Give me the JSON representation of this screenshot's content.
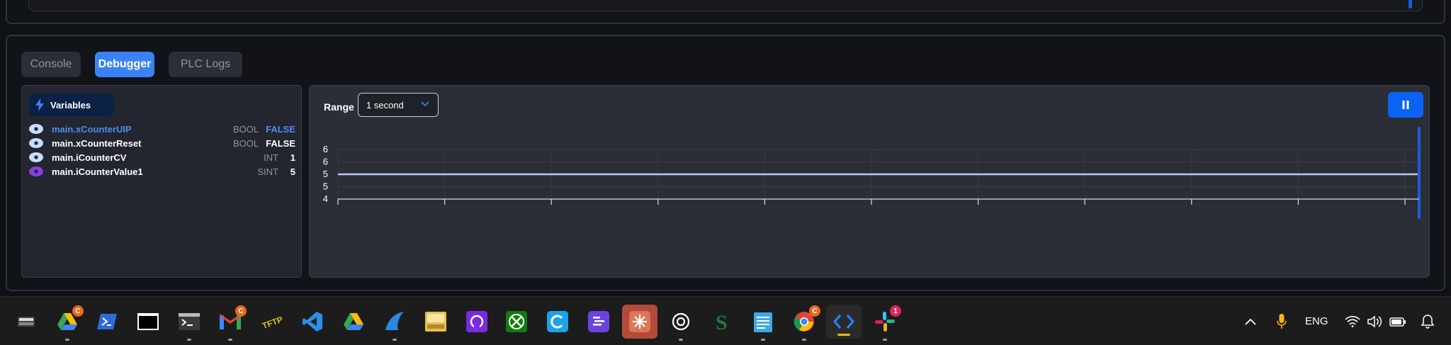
{
  "tabs": [
    {
      "label": "Console",
      "active": false
    },
    {
      "label": "Debugger",
      "active": true
    },
    {
      "label": "PLC Logs",
      "active": false
    }
  ],
  "variables": {
    "header": "Variables",
    "rows": [
      {
        "name": "main.xCounterUIP",
        "type": "BOOL",
        "value": "FALSE",
        "highlight": true,
        "eye_color": "#c7dcff"
      },
      {
        "name": "main.xCounterReset",
        "type": "BOOL",
        "value": "FALSE",
        "highlight": false,
        "eye_color": "#c7dcff"
      },
      {
        "name": "main.iCounterCV",
        "type": "INT",
        "value": "1",
        "highlight": false,
        "eye_color": "#c7dcff"
      },
      {
        "name": "main.iCounterValue1",
        "type": "SINT",
        "value": "5",
        "highlight": false,
        "eye_color": "#8a3fe0"
      }
    ]
  },
  "range": {
    "label": "Range",
    "selected": "1 second"
  },
  "chart_data": {
    "type": "line",
    "title": "",
    "xlabel": "",
    "ylabel": "",
    "y_tick_labels": [
      "6",
      "6",
      "5",
      "5",
      "4"
    ],
    "ylim": [
      4,
      6
    ],
    "grid": true,
    "series": [
      {
        "values": [
          5,
          5,
          5,
          5,
          5,
          5,
          5,
          5,
          5,
          5,
          5
        ],
        "color": "#b8ccf2"
      }
    ]
  },
  "taskbar": {
    "badge_c": "C",
    "badge_slack": "1",
    "language": "ENG",
    "icons": [
      "pinball-icon",
      "google-drive-icon",
      "powershell-icon",
      "terminal-icon",
      "console-icon",
      "gmail-icon",
      "tftp-icon",
      "vscode-icon",
      "google-drive-icon",
      "wireshark-icon",
      "notes-app-icon",
      "ai-app-icon",
      "xbox-icon",
      "cclean-icon",
      "clickup-icon",
      "claude-icon",
      "chatgpt-icon",
      "s-app-icon",
      "notepad-icon",
      "chrome-icon",
      "code-icon",
      "slack-icon"
    ]
  },
  "colors": {
    "accent": "#3b82f6",
    "pause": "#0b63f5",
    "header_bg": "#0b2146"
  }
}
